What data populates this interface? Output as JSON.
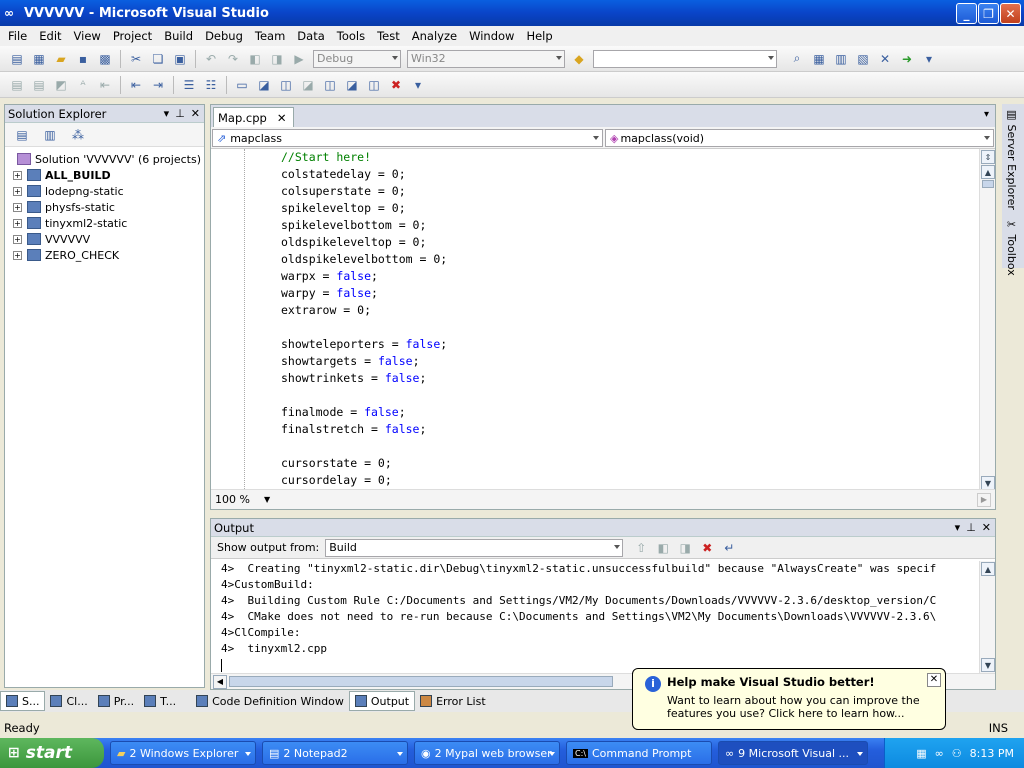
{
  "window": {
    "title": "VVVVVV - Microsoft Visual Studio"
  },
  "menu": [
    "File",
    "Edit",
    "View",
    "Project",
    "Build",
    "Debug",
    "Team",
    "Data",
    "Tools",
    "Test",
    "Analyze",
    "Window",
    "Help"
  ],
  "toolbar": {
    "config": "Debug",
    "platform": "Win32"
  },
  "solution_explorer": {
    "title": "Solution Explorer",
    "solution": "Solution 'VVVVVV' (6 projects)",
    "projects": [
      "ALL_BUILD",
      "lodepng-static",
      "physfs-static",
      "tinyxml2-static",
      "VVVVVV",
      "ZERO_CHECK"
    ]
  },
  "editor": {
    "tab": "Map.cpp",
    "scope": "mapclass",
    "member": "mapclass(void)",
    "zoom": "100 %"
  },
  "code_lines": [
    [
      {
        "c": "cmt",
        "t": "//Start here!"
      }
    ],
    [
      {
        "t": "colstatedelay = 0;"
      }
    ],
    [
      {
        "t": "colsuperstate = 0;"
      }
    ],
    [
      {
        "t": "spikeleveltop = 0;"
      }
    ],
    [
      {
        "t": "spikelevelbottom = 0;"
      }
    ],
    [
      {
        "t": "oldspikeleveltop = 0;"
      }
    ],
    [
      {
        "t": "oldspikelevelbottom = 0;"
      }
    ],
    [
      {
        "t": "warpx = "
      },
      {
        "c": "kw",
        "t": "false"
      },
      {
        "t": ";"
      }
    ],
    [
      {
        "t": "warpy = "
      },
      {
        "c": "kw",
        "t": "false"
      },
      {
        "t": ";"
      }
    ],
    [
      {
        "t": "extrarow = 0;"
      }
    ],
    [
      {
        "t": ""
      }
    ],
    [
      {
        "t": "showteleporters = "
      },
      {
        "c": "kw",
        "t": "false"
      },
      {
        "t": ";"
      }
    ],
    [
      {
        "t": "showtargets = "
      },
      {
        "c": "kw",
        "t": "false"
      },
      {
        "t": ";"
      }
    ],
    [
      {
        "t": "showtrinkets = "
      },
      {
        "c": "kw",
        "t": "false"
      },
      {
        "t": ";"
      }
    ],
    [
      {
        "t": ""
      }
    ],
    [
      {
        "t": "finalmode = "
      },
      {
        "c": "kw",
        "t": "false"
      },
      {
        "t": ";"
      }
    ],
    [
      {
        "t": "finalstretch = "
      },
      {
        "c": "kw",
        "t": "false"
      },
      {
        "t": ";"
      }
    ],
    [
      {
        "t": ""
      }
    ],
    [
      {
        "t": "cursorstate = 0;"
      }
    ],
    [
      {
        "t": "cursordelay = 0;"
      }
    ]
  ],
  "output": {
    "title": "Output",
    "show_from_label": "Show output from:",
    "show_from_value": "Build",
    "lines": [
      "4>  Creating \"tinyxml2-static.dir\\Debug\\tinyxml2-static.unsuccessfulbuild\" because \"AlwaysCreate\" was specif",
      "4>CustomBuild:",
      "4>  Building Custom Rule C:/Documents and Settings/VM2/My Documents/Downloads/VVVVVV-2.3.6/desktop_version/C",
      "4>  CMake does not need to re-run because C:\\Documents and Settings\\VM2\\My Documents\\Downloads\\VVVVVV-2.3.6\\",
      "4>ClCompile:",
      "4>  tinyxml2.cpp"
    ]
  },
  "bottom_tabs": {
    "left": [
      "S...",
      "Cl...",
      "Pr...",
      "T..."
    ],
    "right": [
      "Code Definition Window",
      "Output",
      "Error List"
    ]
  },
  "side_tabs": [
    "Server Explorer",
    "Toolbox"
  ],
  "status": {
    "left": "Ready",
    "right": "INS"
  },
  "balloon": {
    "title": "Help make Visual Studio better!",
    "body": "Want to learn about how you can improve the features you use? Click here to learn how..."
  },
  "taskbar": {
    "start": "start",
    "tasks": [
      "2 Windows Explorer",
      "2 Notepad2",
      "2 Mypal web browser",
      "Command Prompt",
      "9 Microsoft Visual ..."
    ],
    "clock": "8:13 PM"
  }
}
